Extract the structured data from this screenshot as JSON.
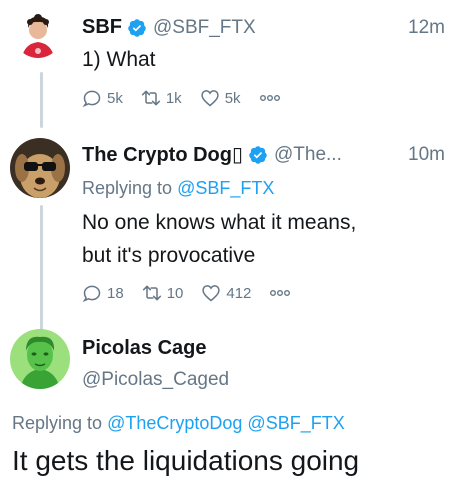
{
  "tweets": [
    {
      "name": "SBF",
      "handle": "@SBF_FTX",
      "time": "12m",
      "text": "1) What",
      "verified": true,
      "replies": "5k",
      "retweets": "1k",
      "likes": "5k"
    },
    {
      "name": "The Crypto Dog▯",
      "handle": "@The...",
      "time": "10m",
      "replying_label": "Replying to",
      "replying_to": "@SBF_FTX",
      "text_line1": "No one knows what it means,",
      "text_line2": "but it's provocative",
      "verified": true,
      "replies": "18",
      "retweets": "10",
      "likes": "412"
    },
    {
      "name": "Picolas Cage",
      "handle": "@Picolas_Caged",
      "replying_label": "Replying to",
      "replying_to_1": "@TheCryptoDog",
      "replying_to_2": "@SBF_FTX",
      "text": "It gets the liquidations going"
    }
  ],
  "colors": {
    "accent": "#1da1f2",
    "muted": "#657786",
    "text": "#14171a",
    "thread_line": "#ccd6dd"
  },
  "icons": [
    "verified-badge-icon",
    "reply-icon",
    "retweet-icon",
    "like-icon",
    "more-icon"
  ]
}
